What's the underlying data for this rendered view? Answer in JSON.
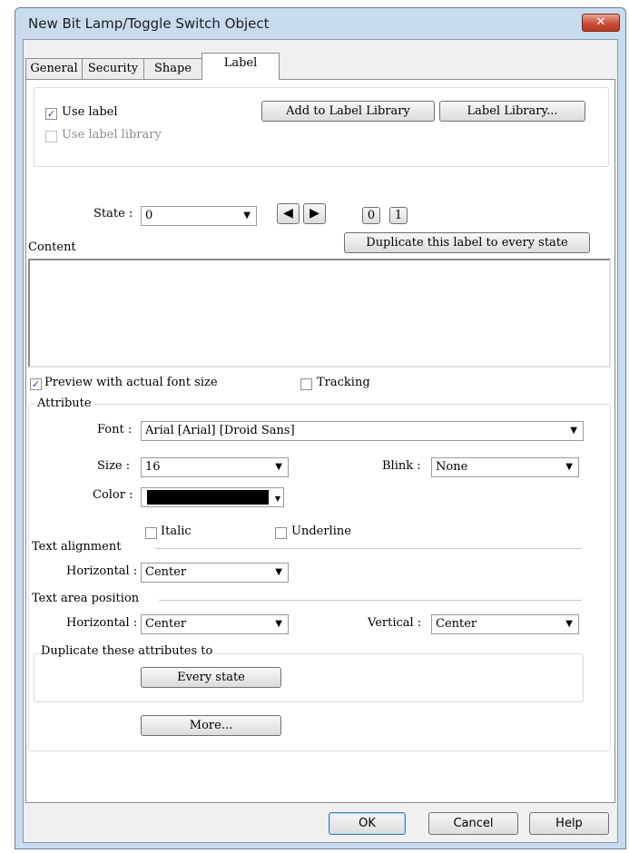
{
  "window": {
    "title": "New Bit Lamp/Toggle Switch Object",
    "close_label": "✕"
  },
  "tabs": [
    {
      "label": "General"
    },
    {
      "label": "Security"
    },
    {
      "label": "Shape"
    },
    {
      "label": "Label"
    }
  ],
  "label_options": {
    "use_label": "Use label",
    "use_label_checked": "✓",
    "use_label_library": "Use label library",
    "add_to_library_button": "Add to Label Library",
    "library_button": "Label Library..."
  },
  "state": {
    "label": "State :",
    "value": "0",
    "prev_icon": "◀",
    "next_icon": "▶",
    "quick_0": "0",
    "quick_1": "1"
  },
  "content": {
    "label": "Content",
    "duplicate_button": "Duplicate this label to every state",
    "text": ""
  },
  "preview": {
    "label": "Preview with actual font size",
    "checked": "✓"
  },
  "tracking": {
    "label": "Tracking"
  },
  "attribute": {
    "group_label": "Attribute",
    "font_label": "Font :",
    "font_value": "Arial [Arial] [Droid Sans]",
    "size_label": "Size :",
    "size_value": "16",
    "blink_label": "Blink :",
    "blink_value": "None",
    "color_label": "Color :",
    "color_value": "#000000",
    "italic_label": "Italic",
    "underline_label": "Underline"
  },
  "text_alignment": {
    "label": "Text alignment",
    "horizontal_label": "Horizontal :",
    "horizontal_value": "Center"
  },
  "text_area_position": {
    "label": "Text area position",
    "horizontal_label": "Horizontal :",
    "horizontal_value": "Center",
    "vertical_label": "Vertical :",
    "vertical_value": "Center"
  },
  "duplicate_attributes": {
    "label": "Duplicate these attributes to",
    "every_state_button": "Every state"
  },
  "more_button": "More...",
  "footer": {
    "ok": "OK",
    "cancel": "Cancel",
    "help": "Help"
  },
  "dropdown_icon": "▼"
}
